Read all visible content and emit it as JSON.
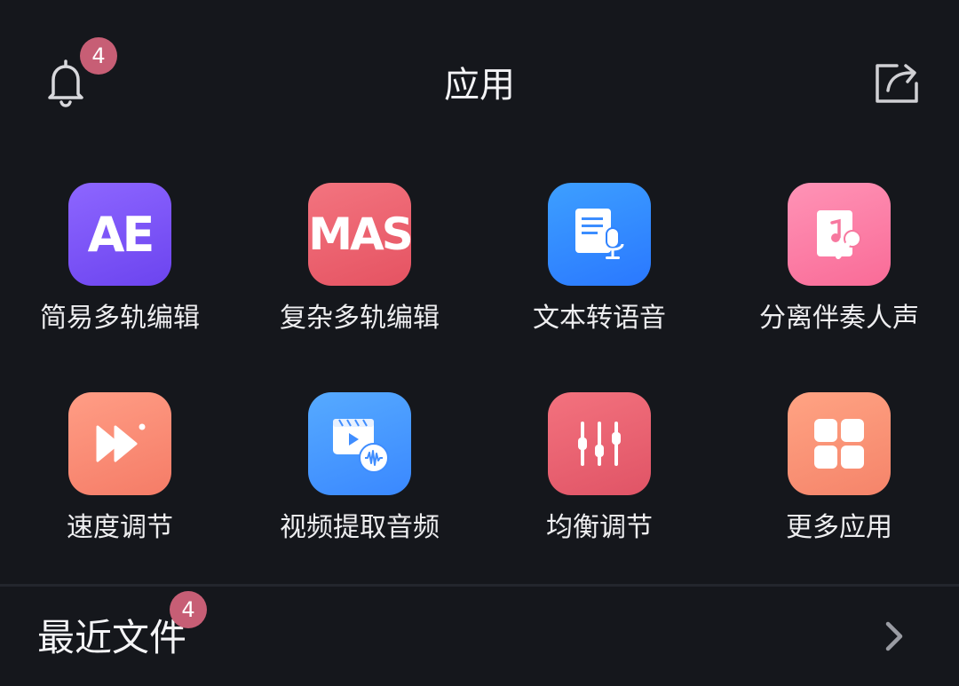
{
  "header": {
    "title": "应用",
    "notification_count": "4"
  },
  "apps": [
    {
      "label": "简易多轨编辑",
      "icon_text": "AE",
      "icon": "ae-logo-icon",
      "gradient": [
        "#8a63ff",
        "#6f46f0"
      ]
    },
    {
      "label": "复杂多轨编辑",
      "icon_text": "MAS",
      "icon": "mas-logo-icon",
      "gradient": [
        "#f2707c",
        "#e85563"
      ]
    },
    {
      "label": "文本转语音",
      "icon": "document-microphone-icon",
      "gradient": [
        "#3a9bff",
        "#2c7bff"
      ]
    },
    {
      "label": "分离伴奏人声",
      "icon": "music-note-karaoke-icon",
      "gradient": [
        "#ff8fb4",
        "#fb6f9b"
      ]
    },
    {
      "label": "速度调节",
      "icon": "fast-forward-icon",
      "gradient": [
        "#ff9a82",
        "#f77f6a"
      ]
    },
    {
      "label": "视频提取音频",
      "icon": "video-audio-extract-icon",
      "gradient": [
        "#52a7ff",
        "#3c8cff"
      ]
    },
    {
      "label": "均衡调节",
      "icon": "equalizer-sliders-icon",
      "gradient": [
        "#f2707c",
        "#e45868"
      ]
    },
    {
      "label": "更多应用",
      "icon": "grid-apps-icon",
      "gradient": [
        "#ffa07e",
        "#f7866a"
      ]
    }
  ],
  "recent": {
    "label": "最近文件",
    "count": "4"
  },
  "colors": {
    "background": "#15171c",
    "badge": "#c75e75"
  }
}
